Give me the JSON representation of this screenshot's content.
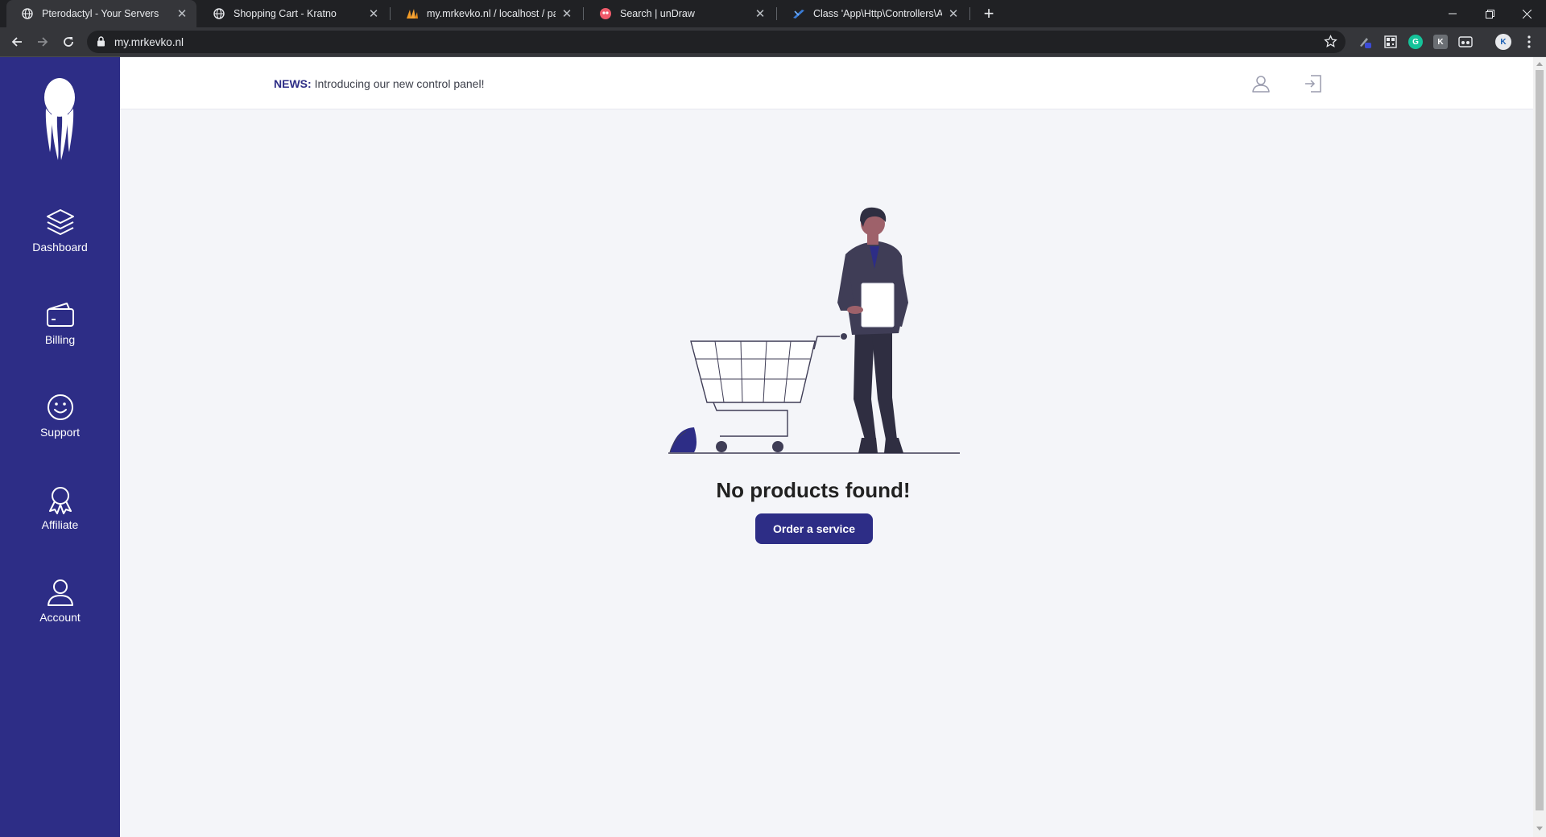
{
  "browser": {
    "tabs": [
      {
        "title": "Pterodactyl - Your Servers",
        "icon": "globe-icon",
        "active": true
      },
      {
        "title": "Shopping Cart - Kratno",
        "icon": "globe-icon",
        "active": false
      },
      {
        "title": "my.mrkevko.nl / localhost / panel",
        "icon": "phpmyadmin-icon",
        "active": false
      },
      {
        "title": "Search | unDraw",
        "icon": "undraw-icon",
        "active": false
      },
      {
        "title": "Class 'App\\Http\\Controllers\\Auth",
        "icon": "vscode-icon",
        "active": false
      }
    ],
    "url": "my.mrkevko.nl",
    "profile_initial": "K"
  },
  "sidebar": {
    "items": [
      {
        "label": "Dashboard",
        "icon": "layers-icon"
      },
      {
        "label": "Billing",
        "icon": "wallet-icon"
      },
      {
        "label": "Support",
        "icon": "smiley-icon"
      },
      {
        "label": "Affiliate",
        "icon": "award-icon"
      },
      {
        "label": "Account",
        "icon": "user-icon"
      }
    ]
  },
  "header": {
    "news_label": "NEWS:",
    "news_text": "Introducing our new control panel!"
  },
  "main": {
    "empty_title": "No products found!",
    "order_button": "Order a service"
  },
  "colors": {
    "brand": "#2d2d86",
    "page_bg": "#f4f5f9",
    "chrome_dark": "#202124",
    "chrome_toolbar": "#35363a"
  }
}
